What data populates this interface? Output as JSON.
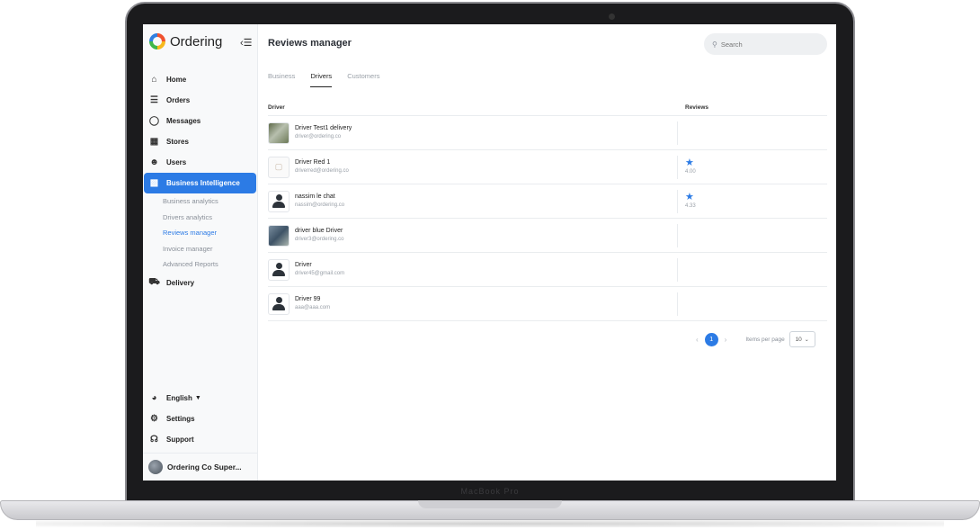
{
  "device": {
    "bezel_label": "MacBook Pro"
  },
  "sidebar": {
    "logo_text": "Ordering",
    "collapse_icon": "collapse-menu-icon",
    "items": [
      {
        "label": "Home",
        "icon": "home-icon"
      },
      {
        "label": "Orders",
        "icon": "list-icon"
      },
      {
        "label": "Messages",
        "icon": "chat-icon"
      },
      {
        "label": "Stores",
        "icon": "store-icon"
      },
      {
        "label": "Users",
        "icon": "users-icon"
      },
      {
        "label": "Business Intelligence",
        "icon": "bar-chart-icon",
        "active": true
      },
      {
        "label": "Delivery",
        "icon": "truck-icon"
      }
    ],
    "sub_items": [
      {
        "label": "Business analytics"
      },
      {
        "label": "Drivers analytics"
      },
      {
        "label": "Reviews manager",
        "active": true
      },
      {
        "label": "Invoice manager"
      },
      {
        "label": "Advanced Reports"
      }
    ],
    "bottom": [
      {
        "label": "English",
        "icon": "globe-icon"
      },
      {
        "label": "Settings",
        "icon": "gear-icon"
      },
      {
        "label": "Support",
        "icon": "headset-icon"
      }
    ],
    "user": {
      "name": "Ordering Co Super..."
    }
  },
  "main": {
    "title": "Reviews manager",
    "search": {
      "placeholder": "Search",
      "value": ""
    },
    "tabs": [
      {
        "label": "Business"
      },
      {
        "label": "Drivers",
        "active": true
      },
      {
        "label": "Customers"
      }
    ],
    "table": {
      "headers": [
        "Driver",
        "Reviews"
      ],
      "rows": [
        {
          "name": "Driver Test1 delivery",
          "email": "driver@ordering.co",
          "rating": "",
          "photo": "photo"
        },
        {
          "name": "Driver Red 1",
          "email": "driverred@ordering.co",
          "rating": "4.00",
          "photo": "paper"
        },
        {
          "name": "nassim le chat",
          "email": "nassim@ordering.co",
          "rating": "4.33",
          "photo": "default"
        },
        {
          "name": "driver blue Driver",
          "email": "driver3@ordering.co",
          "rating": "",
          "photo": "photo2"
        },
        {
          "name": "Driver",
          "email": "driver45@gmail.com",
          "rating": "",
          "photo": "default"
        },
        {
          "name": "Driver 99",
          "email": "aaa@aaa.com",
          "rating": "",
          "photo": "default"
        }
      ]
    },
    "pagination": {
      "current_page": "1",
      "items_per_page_label": "Items per page",
      "items_per_page": "10"
    }
  },
  "colors": {
    "accent": "#2c7be5",
    "sidebar_bg": "#f8f9fa"
  }
}
